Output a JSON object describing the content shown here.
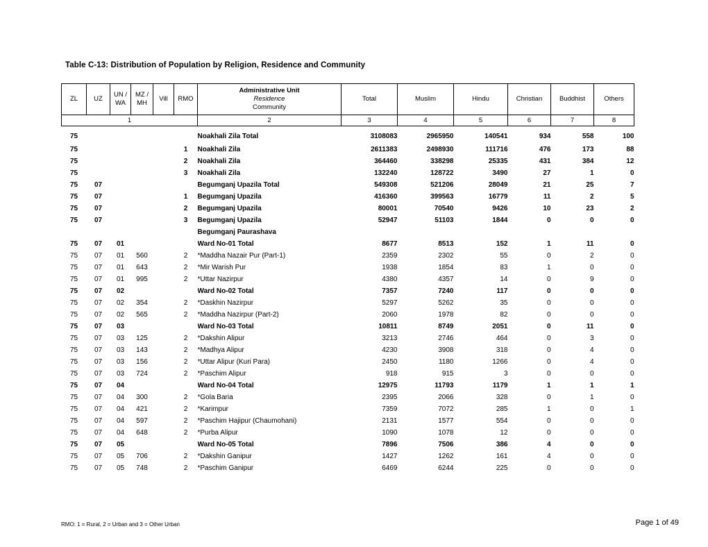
{
  "document": {
    "title": "Table C-13: Distribution of Population by Religion, Residence and Community"
  },
  "table": {
    "headers": {
      "zl": "ZL",
      "uz": "UZ",
      "un_wa": "UN / WA",
      "un_wa_l1": "UN /",
      "un_wa_l2": "WA",
      "mz_mh_l1": "MZ /",
      "mz_mh_l2": "MH",
      "vill": "Vill",
      "rmo": "RMO",
      "admin_l1": "Administrative Unit",
      "admin_l2": "Residence",
      "admin_l3": "Community",
      "total": "Total",
      "muslim": "Muslim",
      "hindu": "Hindu",
      "christian": "Christian",
      "buddhist": "Buddhist",
      "others": "Others"
    },
    "column_numbers": {
      "group1": "1",
      "admin": "2",
      "total": "3",
      "muslim": "4",
      "hindu": "5",
      "christian": "6",
      "buddhist": "7",
      "others": "8"
    },
    "rows": [
      {
        "zl": "75",
        "uz": "",
        "un": "",
        "mz": "",
        "vill": "",
        "rmo": "",
        "admin": "Noakhali Zila Total",
        "indent": 0,
        "bold": true,
        "total": "3108083",
        "muslim": "2965950",
        "hindu": "140541",
        "christian": "934",
        "buddhist": "558",
        "others": "100"
      },
      {
        "zl": "75",
        "uz": "",
        "un": "",
        "mz": "",
        "vill": "",
        "rmo": "1",
        "admin": "Noakhali Zila",
        "indent": 1,
        "bold": true,
        "total": "2611383",
        "muslim": "2498930",
        "hindu": "111716",
        "christian": "476",
        "buddhist": "173",
        "others": "88"
      },
      {
        "zl": "75",
        "uz": "",
        "un": "",
        "mz": "",
        "vill": "",
        "rmo": "2",
        "admin": "Noakhali Zila",
        "indent": 1,
        "bold": true,
        "total": "364460",
        "muslim": "338298",
        "hindu": "25335",
        "christian": "431",
        "buddhist": "384",
        "others": "12"
      },
      {
        "zl": "75",
        "uz": "",
        "un": "",
        "mz": "",
        "vill": "",
        "rmo": "3",
        "admin": "Noakhali Zila",
        "indent": 1,
        "bold": true,
        "total": "132240",
        "muslim": "128722",
        "hindu": "3490",
        "christian": "27",
        "buddhist": "1",
        "others": "0"
      },
      {
        "zl": "75",
        "uz": "07",
        "un": "",
        "mz": "",
        "vill": "",
        "rmo": "",
        "admin": "Begumganj Upazila Total",
        "indent": 0,
        "bold": true,
        "total": "549308",
        "muslim": "521206",
        "hindu": "28049",
        "christian": "21",
        "buddhist": "25",
        "others": "7"
      },
      {
        "zl": "75",
        "uz": "07",
        "un": "",
        "mz": "",
        "vill": "",
        "rmo": "1",
        "admin": "Begumganj Upazila",
        "indent": 1,
        "bold": true,
        "total": "416360",
        "muslim": "399563",
        "hindu": "16779",
        "christian": "11",
        "buddhist": "2",
        "others": "5"
      },
      {
        "zl": "75",
        "uz": "07",
        "un": "",
        "mz": "",
        "vill": "",
        "rmo": "2",
        "admin": "Begumganj Upazila",
        "indent": 1,
        "bold": true,
        "total": "80001",
        "muslim": "70540",
        "hindu": "9426",
        "christian": "10",
        "buddhist": "23",
        "others": "2"
      },
      {
        "zl": "75",
        "uz": "07",
        "un": "",
        "mz": "",
        "vill": "",
        "rmo": "3",
        "admin": "Begumganj Upazila",
        "indent": 1,
        "bold": true,
        "total": "52947",
        "muslim": "51103",
        "hindu": "1844",
        "christian": "0",
        "buddhist": "0",
        "others": "0"
      },
      {
        "zl": "",
        "uz": "",
        "un": "",
        "mz": "",
        "vill": "",
        "rmo": "",
        "admin": "Begumganj Paurashava",
        "indent": 1,
        "bold": true,
        "total": "",
        "muslim": "",
        "hindu": "",
        "christian": "",
        "buddhist": "",
        "others": ""
      },
      {
        "zl": "75",
        "uz": "07",
        "un": "01",
        "mz": "",
        "vill": "",
        "rmo": "",
        "admin": "Ward No-01 Total",
        "indent": 0,
        "bold": true,
        "total": "8677",
        "muslim": "8513",
        "hindu": "152",
        "christian": "1",
        "buddhist": "11",
        "others": "0"
      },
      {
        "zl": "75",
        "uz": "07",
        "un": "01",
        "mz": "560",
        "vill": "",
        "rmo": "2",
        "admin": "*Maddha Nazair Pur (Part-1)",
        "indent": 0,
        "bold": false,
        "total": "2359",
        "muslim": "2302",
        "hindu": "55",
        "christian": "0",
        "buddhist": "2",
        "others": "0"
      },
      {
        "zl": "75",
        "uz": "07",
        "un": "01",
        "mz": "643",
        "vill": "",
        "rmo": "2",
        "admin": "*Mir Warish Pur",
        "indent": 0,
        "bold": false,
        "total": "1938",
        "muslim": "1854",
        "hindu": "83",
        "christian": "1",
        "buddhist": "0",
        "others": "0"
      },
      {
        "zl": "75",
        "uz": "07",
        "un": "01",
        "mz": "995",
        "vill": "",
        "rmo": "2",
        "admin": "*Uttar Nazirpur",
        "indent": 0,
        "bold": false,
        "total": "4380",
        "muslim": "4357",
        "hindu": "14",
        "christian": "0",
        "buddhist": "9",
        "others": "0"
      },
      {
        "zl": "75",
        "uz": "07",
        "un": "02",
        "mz": "",
        "vill": "",
        "rmo": "",
        "admin": "Ward No-02 Total",
        "indent": 0,
        "bold": true,
        "total": "7357",
        "muslim": "7240",
        "hindu": "117",
        "christian": "0",
        "buddhist": "0",
        "others": "0"
      },
      {
        "zl": "75",
        "uz": "07",
        "un": "02",
        "mz": "354",
        "vill": "",
        "rmo": "2",
        "admin": "*Daskhin Nazirpur",
        "indent": 0,
        "bold": false,
        "total": "5297",
        "muslim": "5262",
        "hindu": "35",
        "christian": "0",
        "buddhist": "0",
        "others": "0"
      },
      {
        "zl": "75",
        "uz": "07",
        "un": "02",
        "mz": "565",
        "vill": "",
        "rmo": "2",
        "admin": "*Maddha Nazirpur (Part-2)",
        "indent": 0,
        "bold": false,
        "total": "2060",
        "muslim": "1978",
        "hindu": "82",
        "christian": "0",
        "buddhist": "0",
        "others": "0"
      },
      {
        "zl": "75",
        "uz": "07",
        "un": "03",
        "mz": "",
        "vill": "",
        "rmo": "",
        "admin": "Ward No-03 Total",
        "indent": 0,
        "bold": true,
        "total": "10811",
        "muslim": "8749",
        "hindu": "2051",
        "christian": "0",
        "buddhist": "11",
        "others": "0"
      },
      {
        "zl": "75",
        "uz": "07",
        "un": "03",
        "mz": "125",
        "vill": "",
        "rmo": "2",
        "admin": "*Dakshin Alipur",
        "indent": 0,
        "bold": false,
        "total": "3213",
        "muslim": "2746",
        "hindu": "464",
        "christian": "0",
        "buddhist": "3",
        "others": "0"
      },
      {
        "zl": "75",
        "uz": "07",
        "un": "03",
        "mz": "143",
        "vill": "",
        "rmo": "2",
        "admin": "*Madhya Alipur",
        "indent": 0,
        "bold": false,
        "total": "4230",
        "muslim": "3908",
        "hindu": "318",
        "christian": "0",
        "buddhist": "4",
        "others": "0"
      },
      {
        "zl": "75",
        "uz": "07",
        "un": "03",
        "mz": "156",
        "vill": "",
        "rmo": "2",
        "admin": "*Uttar Alipur (Kuri Para)",
        "indent": 0,
        "bold": false,
        "total": "2450",
        "muslim": "1180",
        "hindu": "1266",
        "christian": "0",
        "buddhist": "4",
        "others": "0"
      },
      {
        "zl": "75",
        "uz": "07",
        "un": "03",
        "mz": "724",
        "vill": "",
        "rmo": "2",
        "admin": "*Paschim Alipur",
        "indent": 0,
        "bold": false,
        "total": "918",
        "muslim": "915",
        "hindu": "3",
        "christian": "0",
        "buddhist": "0",
        "others": "0"
      },
      {
        "zl": "75",
        "uz": "07",
        "un": "04",
        "mz": "",
        "vill": "",
        "rmo": "",
        "admin": "Ward No-04 Total",
        "indent": 0,
        "bold": true,
        "total": "12975",
        "muslim": "11793",
        "hindu": "1179",
        "christian": "1",
        "buddhist": "1",
        "others": "1"
      },
      {
        "zl": "75",
        "uz": "07",
        "un": "04",
        "mz": "300",
        "vill": "",
        "rmo": "2",
        "admin": "*Gola Baria",
        "indent": 0,
        "bold": false,
        "total": "2395",
        "muslim": "2066",
        "hindu": "328",
        "christian": "0",
        "buddhist": "1",
        "others": "0"
      },
      {
        "zl": "75",
        "uz": "07",
        "un": "04",
        "mz": "421",
        "vill": "",
        "rmo": "2",
        "admin": "*Karimpur",
        "indent": 0,
        "bold": false,
        "total": "7359",
        "muslim": "7072",
        "hindu": "285",
        "christian": "1",
        "buddhist": "0",
        "others": "1"
      },
      {
        "zl": "75",
        "uz": "07",
        "un": "04",
        "mz": "597",
        "vill": "",
        "rmo": "2",
        "admin": "*Paschim Hajipur (Chaumohani)",
        "indent": 0,
        "bold": false,
        "total": "2131",
        "muslim": "1577",
        "hindu": "554",
        "christian": "0",
        "buddhist": "0",
        "others": "0"
      },
      {
        "zl": "75",
        "uz": "07",
        "un": "04",
        "mz": "648",
        "vill": "",
        "rmo": "2",
        "admin": "*Purba Alipur",
        "indent": 0,
        "bold": false,
        "total": "1090",
        "muslim": "1078",
        "hindu": "12",
        "christian": "0",
        "buddhist": "0",
        "others": "0"
      },
      {
        "zl": "75",
        "uz": "07",
        "un": "05",
        "mz": "",
        "vill": "",
        "rmo": "",
        "admin": "Ward No-05 Total",
        "indent": 0,
        "bold": true,
        "total": "7896",
        "muslim": "7506",
        "hindu": "386",
        "christian": "4",
        "buddhist": "0",
        "others": "0"
      },
      {
        "zl": "75",
        "uz": "07",
        "un": "05",
        "mz": "706",
        "vill": "",
        "rmo": "2",
        "admin": "*Dakshin Ganipur",
        "indent": 0,
        "bold": false,
        "total": "1427",
        "muslim": "1262",
        "hindu": "161",
        "christian": "4",
        "buddhist": "0",
        "others": "0"
      },
      {
        "zl": "75",
        "uz": "07",
        "un": "05",
        "mz": "748",
        "vill": "",
        "rmo": "2",
        "admin": "*Paschim Ganipur",
        "indent": 0,
        "bold": false,
        "total": "6469",
        "muslim": "6244",
        "hindu": "225",
        "christian": "0",
        "buddhist": "0",
        "others": "0"
      }
    ]
  },
  "footer": {
    "note": "RMO: 1 = Rural, 2 = Urban and 3 = Other Urban",
    "page": "Page 1 of 49"
  }
}
